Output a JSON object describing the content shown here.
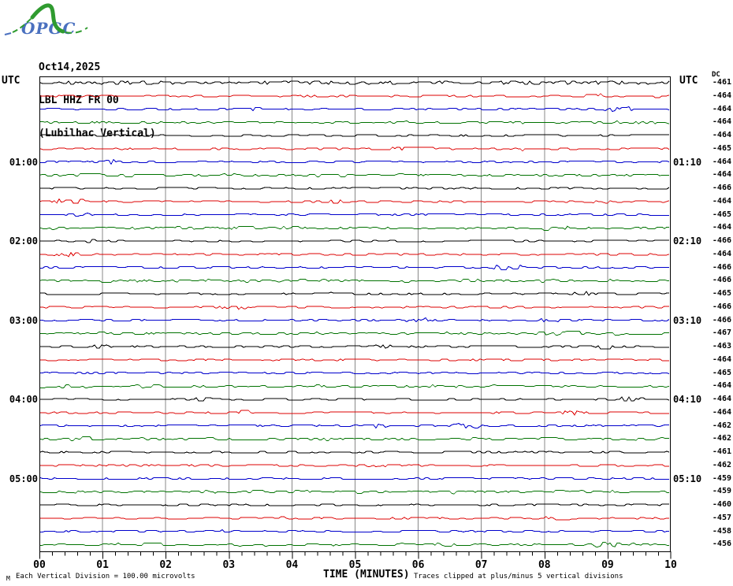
{
  "logo": {
    "text": "OPGC",
    "green": "#2f9b2f",
    "blue": "#4a70bf"
  },
  "header": {
    "date": "Oct14,2025",
    "station": "LBL HHZ FR 00",
    "location": "(Lubilhac Vertical)"
  },
  "axis": {
    "utc_left": "UTC",
    "utc_right": "UTC",
    "dc_header": "DC",
    "xlabel": "TIME (MINUTES)",
    "x_tick_labels": [
      "00",
      "01",
      "02",
      "03",
      "04",
      "05",
      "06",
      "07",
      "08",
      "09",
      "10"
    ]
  },
  "footer": {
    "corner_glyph": "M",
    "division_note": "Each Vertical Division =  100.00 microvolts",
    "clip_note": "Traces clipped at plus/minus 5 vertical divisions"
  },
  "chart_data": {
    "type": "line",
    "title": "LBL HHZ FR 00 (Lubilhac Vertical) Oct14,2025",
    "xlabel": "TIME (MINUTES)",
    "x_range_minutes": [
      0,
      10
    ],
    "x_major_tick_step_minutes": 1,
    "x_minor_tick_step_minutes": 0.2,
    "grid": "vertical gridlines at every minute",
    "rows_per_hour": 6,
    "trace_duration_minutes": 10,
    "vertical_division_microvolts": 100.0,
    "clip_divisions": 5,
    "waveform": "low-amplitude ambient seismic noise, traces essentially flat",
    "colors": {
      "black": "#000000",
      "red": "#dd0000",
      "blue": "#0000cc",
      "green": "#007200",
      "grid": "#888888"
    },
    "left_hour_labels": [
      {
        "row": 6,
        "label": "01:00"
      },
      {
        "row": 12,
        "label": "02:00"
      },
      {
        "row": 18,
        "label": "03:00"
      },
      {
        "row": 24,
        "label": "04:00"
      },
      {
        "row": 30,
        "label": "05:00"
      }
    ],
    "right_hour_labels": [
      {
        "row": 6,
        "label": "01:10"
      },
      {
        "row": 12,
        "label": "02:10"
      },
      {
        "row": 18,
        "label": "03:10"
      },
      {
        "row": 24,
        "label": "04:10"
      },
      {
        "row": 30,
        "label": "05:10"
      }
    ],
    "traces": [
      {
        "start": "00:00",
        "end": "00:10",
        "color": "black",
        "dc": -461
      },
      {
        "start": "00:10",
        "end": "00:20",
        "color": "red",
        "dc": -464
      },
      {
        "start": "00:20",
        "end": "00:30",
        "color": "blue",
        "dc": -464
      },
      {
        "start": "00:30",
        "end": "00:40",
        "color": "green",
        "dc": -464
      },
      {
        "start": "00:40",
        "end": "00:50",
        "color": "black",
        "dc": -464
      },
      {
        "start": "00:50",
        "end": "01:00",
        "color": "red",
        "dc": -465
      },
      {
        "start": "01:00",
        "end": "01:10",
        "color": "blue",
        "dc": -464
      },
      {
        "start": "01:10",
        "end": "01:20",
        "color": "green",
        "dc": -464
      },
      {
        "start": "01:20",
        "end": "01:30",
        "color": "black",
        "dc": -466
      },
      {
        "start": "01:30",
        "end": "01:40",
        "color": "red",
        "dc": -464
      },
      {
        "start": "01:40",
        "end": "01:50",
        "color": "blue",
        "dc": -465
      },
      {
        "start": "01:50",
        "end": "02:00",
        "color": "green",
        "dc": -464
      },
      {
        "start": "02:00",
        "end": "02:10",
        "color": "black",
        "dc": -466
      },
      {
        "start": "02:10",
        "end": "02:20",
        "color": "red",
        "dc": -464
      },
      {
        "start": "02:20",
        "end": "02:30",
        "color": "blue",
        "dc": -466
      },
      {
        "start": "02:30",
        "end": "02:40",
        "color": "green",
        "dc": -466
      },
      {
        "start": "02:40",
        "end": "02:50",
        "color": "black",
        "dc": -465
      },
      {
        "start": "02:50",
        "end": "03:00",
        "color": "red",
        "dc": -466
      },
      {
        "start": "03:00",
        "end": "03:10",
        "color": "blue",
        "dc": -466
      },
      {
        "start": "03:10",
        "end": "03:20",
        "color": "green",
        "dc": -467
      },
      {
        "start": "03:20",
        "end": "03:30",
        "color": "black",
        "dc": -463
      },
      {
        "start": "03:30",
        "end": "03:40",
        "color": "red",
        "dc": -464
      },
      {
        "start": "03:40",
        "end": "03:50",
        "color": "blue",
        "dc": -465
      },
      {
        "start": "03:50",
        "end": "04:00",
        "color": "green",
        "dc": -464
      },
      {
        "start": "04:00",
        "end": "04:10",
        "color": "black",
        "dc": -464
      },
      {
        "start": "04:10",
        "end": "04:20",
        "color": "red",
        "dc": -464
      },
      {
        "start": "04:20",
        "end": "04:30",
        "color": "blue",
        "dc": -462
      },
      {
        "start": "04:30",
        "end": "04:40",
        "color": "green",
        "dc": -462
      },
      {
        "start": "04:40",
        "end": "04:50",
        "color": "black",
        "dc": -461
      },
      {
        "start": "04:50",
        "end": "05:00",
        "color": "red",
        "dc": -462
      },
      {
        "start": "05:00",
        "end": "05:10",
        "color": "blue",
        "dc": -459
      },
      {
        "start": "05:10",
        "end": "05:20",
        "color": "green",
        "dc": -459
      },
      {
        "start": "05:20",
        "end": "05:30",
        "color": "black",
        "dc": -460
      },
      {
        "start": "05:30",
        "end": "05:40",
        "color": "red",
        "dc": -457
      },
      {
        "start": "05:40",
        "end": "05:50",
        "color": "blue",
        "dc": -458
      },
      {
        "start": "05:50",
        "end": "06:00",
        "color": "green",
        "dc": -456
      }
    ]
  }
}
